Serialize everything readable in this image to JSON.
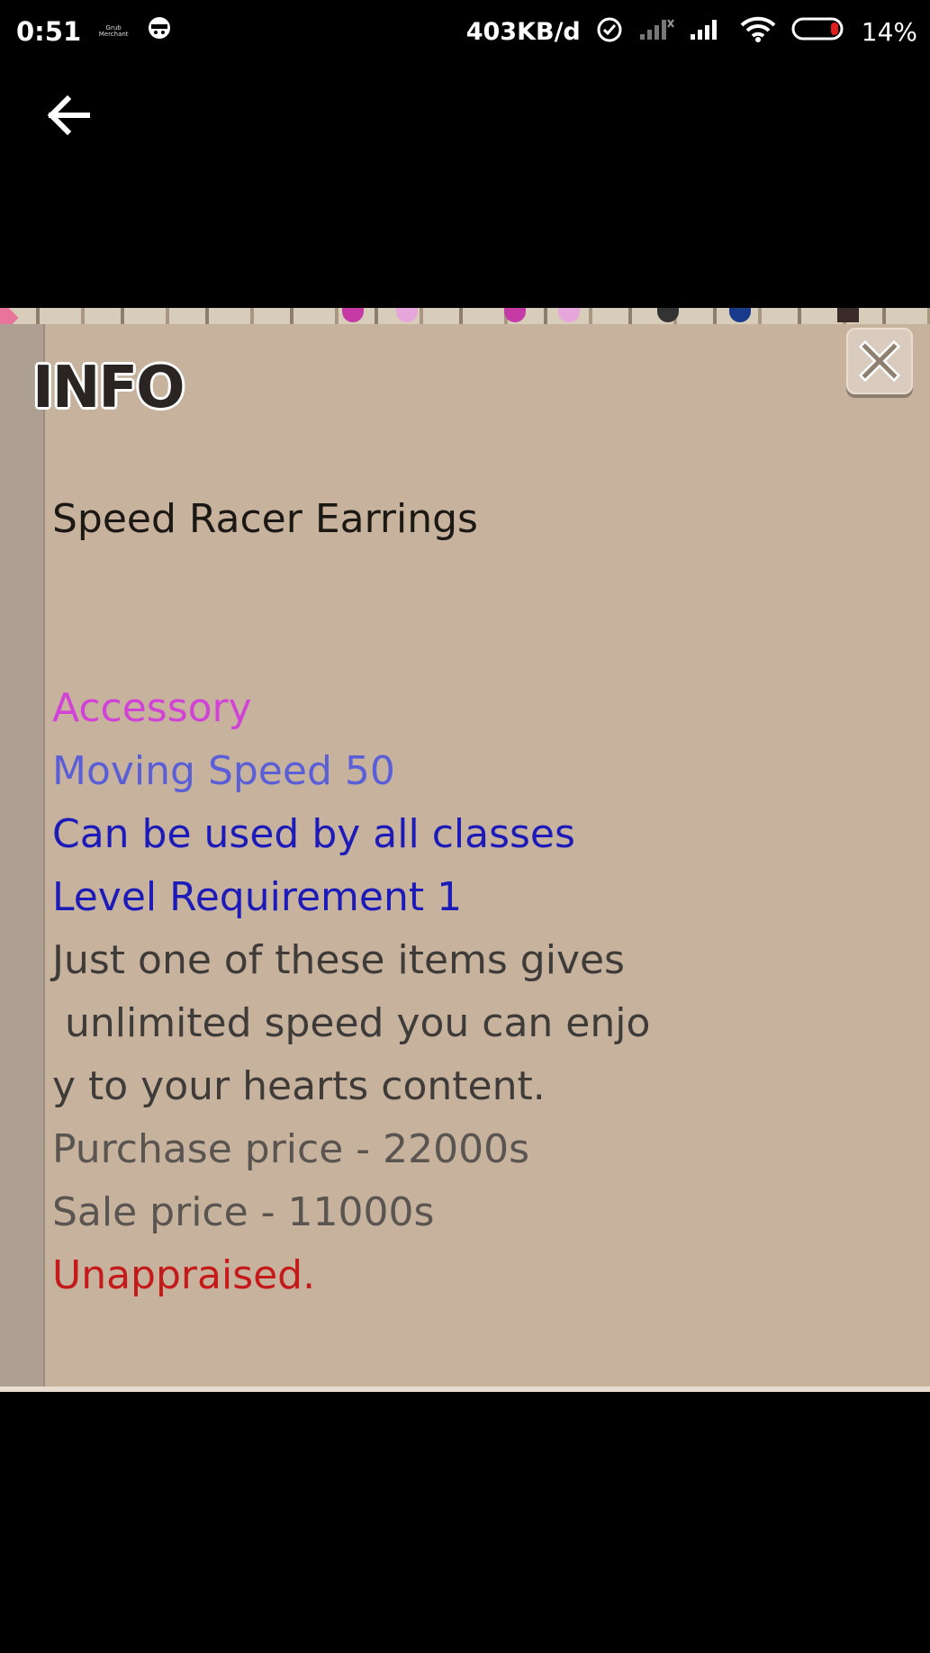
{
  "status_bar": {
    "time": "0:51",
    "tiny_logo_text": "Grub Merchant",
    "speed": "403KB/d",
    "battery": "14%",
    "colors": {
      "battery_low": "#e02020"
    }
  },
  "nav": {
    "back_icon": "arrow-left-icon"
  },
  "info_panel": {
    "title": "INFO",
    "close_icon": "close-x-icon",
    "item_name": "Speed Racer Earrings",
    "lines": {
      "type": "Accessory",
      "stat": "Moving Speed 50",
      "classes": "Can be used by all classes",
      "level": "Level Requirement 1",
      "desc1": "Just one of these items gives",
      "desc2": " unlimited speed you can enjo",
      "desc3": "y to your hearts content.",
      "purchase": "Purchase price - 22000s",
      "sale": "Sale price - 11000s",
      "appraisal": "Unappraised."
    },
    "colors": {
      "panel_bg": "#c7b29e",
      "type": "#d143d6",
      "stat": "#5a5fd8",
      "requirement": "#1c1ab8",
      "unappraised": "#c41a1a"
    }
  }
}
